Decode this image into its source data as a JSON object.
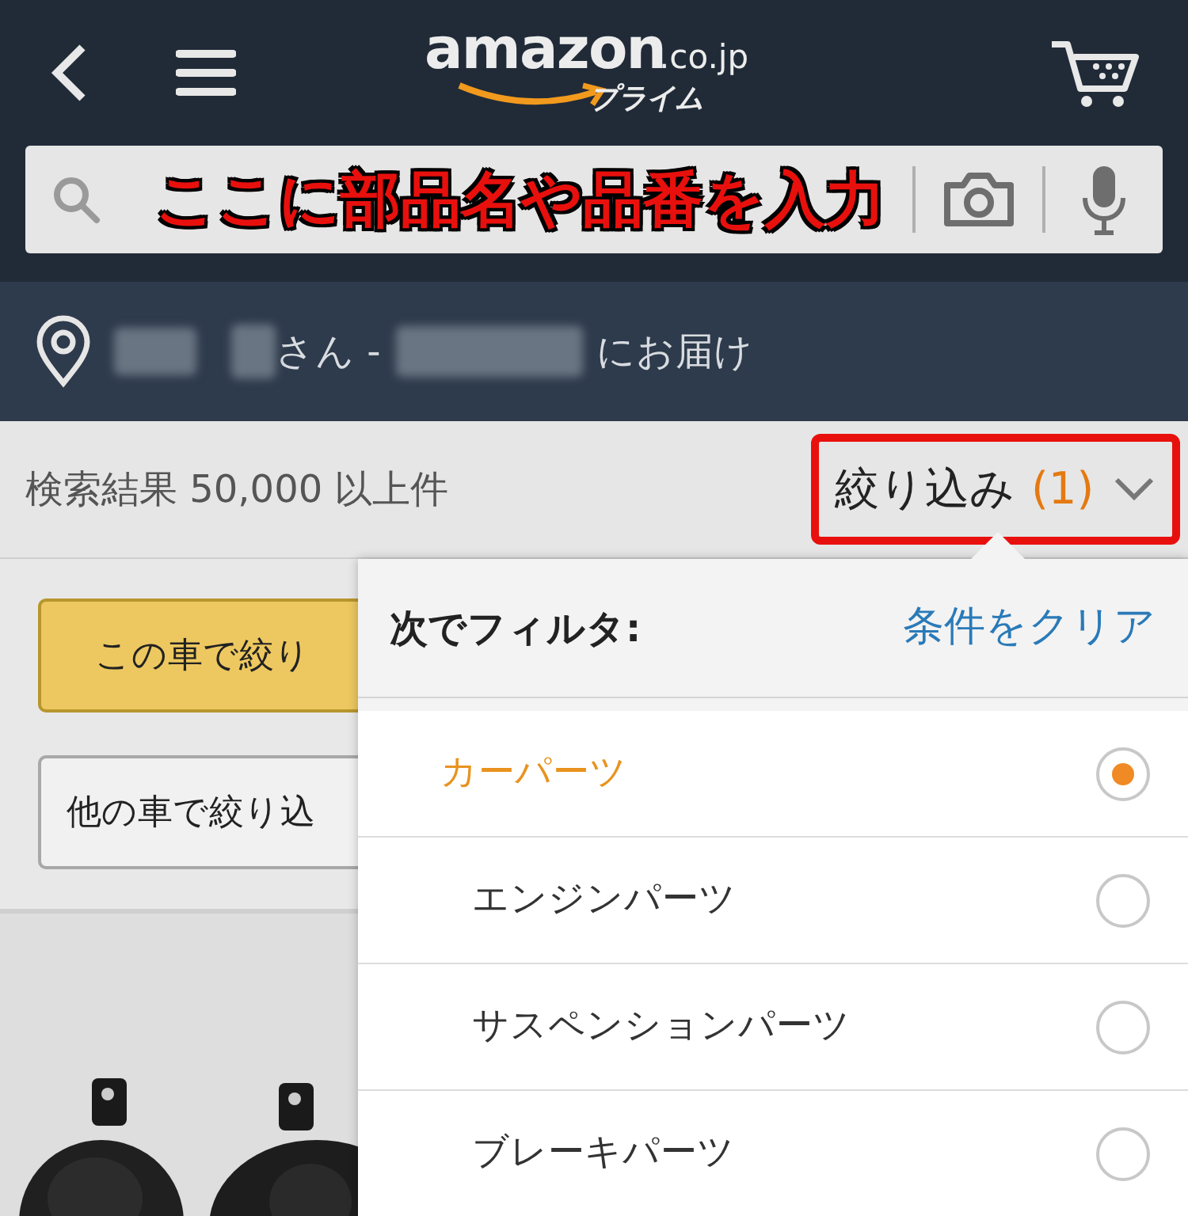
{
  "header": {
    "logo": {
      "wordmark": "amazon",
      "domain": ".co.jp",
      "tagline": "プライム"
    }
  },
  "search": {
    "annotation": "ここに部品名や品番を入力"
  },
  "delivery": {
    "honorific": "さん -",
    "suffix": "にお届け"
  },
  "results": {
    "count_label": "検索結果 50,000 以上件",
    "filter_button": {
      "label": "絞り込み",
      "count": "(1)"
    }
  },
  "vehicle_buttons": [
    {
      "label": "この車で絞り",
      "kind": "primary"
    },
    {
      "label": "他の車で絞り込",
      "kind": "secondary"
    }
  ],
  "filter_panel": {
    "title": "次でフィルタ:",
    "clear": "条件をクリア",
    "options": [
      {
        "label": "カーパーツ",
        "selected": true,
        "children": [
          {
            "label": "エンジンパーツ",
            "selected": false
          },
          {
            "label": "サスペンションパーツ",
            "selected": false
          },
          {
            "label": "ブレーキパーツ",
            "selected": false
          }
        ]
      }
    ]
  }
}
